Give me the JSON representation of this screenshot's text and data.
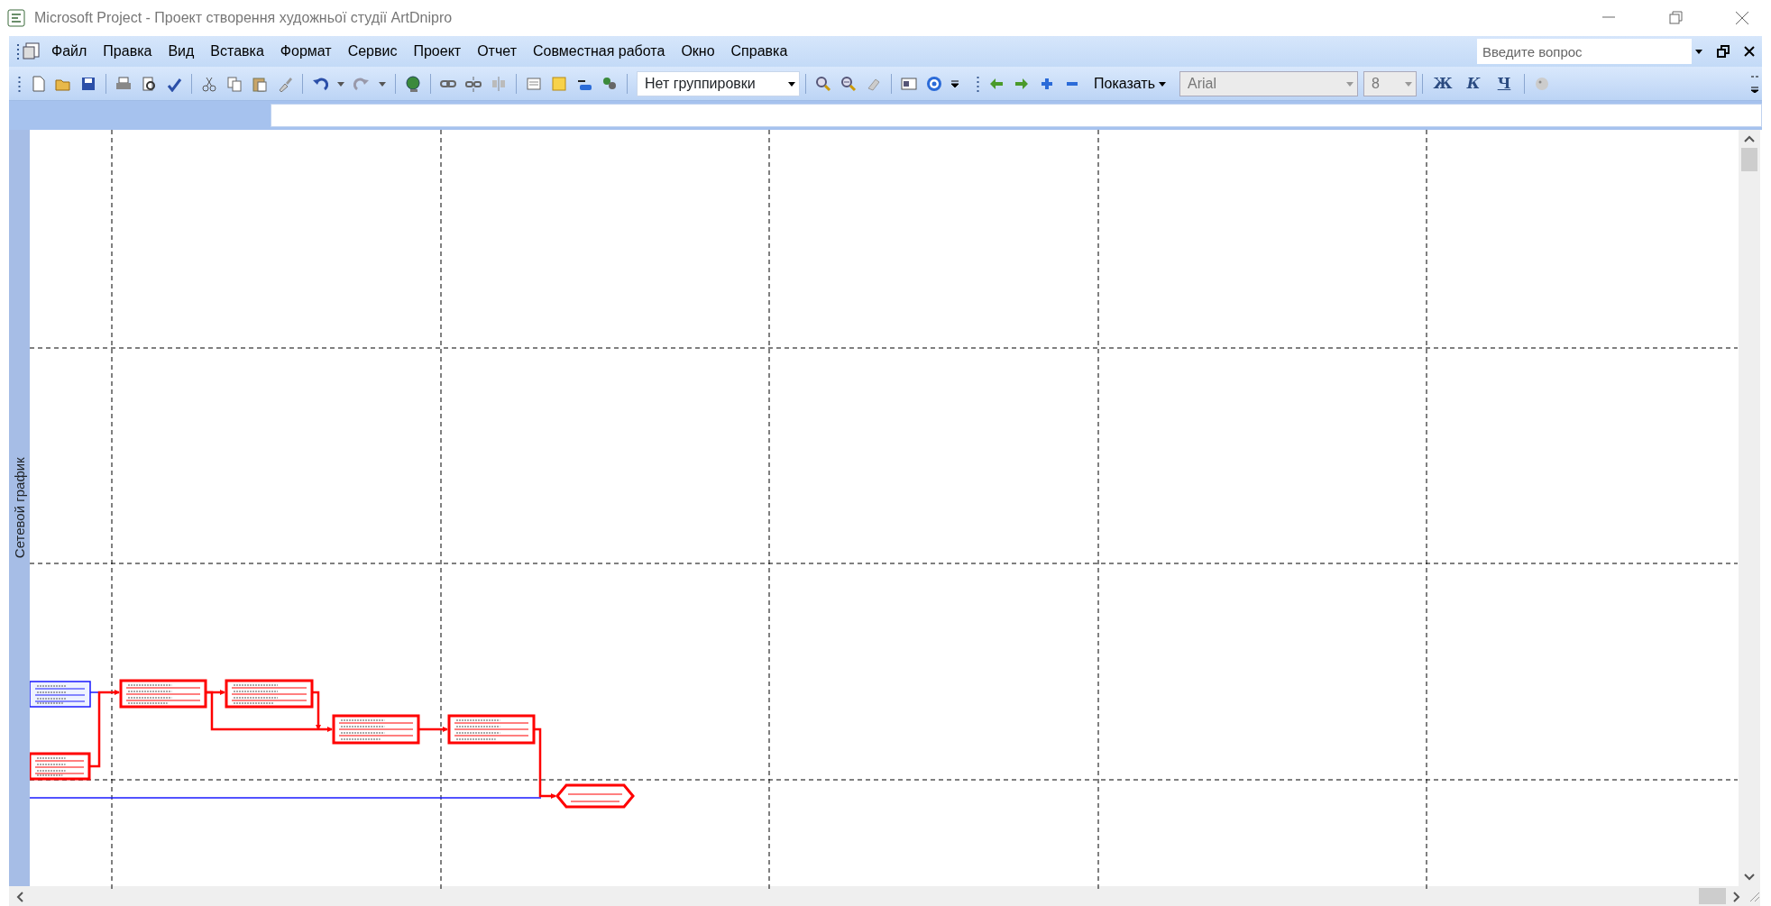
{
  "window": {
    "title": "Microsoft Project - Проект створення художньої студії ArtDnipro"
  },
  "menu": [
    "Файл",
    "Правка",
    "Вид",
    "Вставка",
    "Формат",
    "Сервис",
    "Проект",
    "Отчет",
    "Совместная работа",
    "Окно",
    "Справка"
  ],
  "help_search": {
    "placeholder": "Введите вопрос"
  },
  "toolbar": {
    "grouping": "Нет группировки",
    "show_button": "Показать",
    "font": {
      "value": "Arial",
      "disabled": true
    },
    "font_size": {
      "value": "8",
      "disabled": true
    },
    "format_buttons": [
      "Ж",
      "К",
      "Ч"
    ]
  },
  "view_bar": {
    "label": "Сетевой график"
  }
}
